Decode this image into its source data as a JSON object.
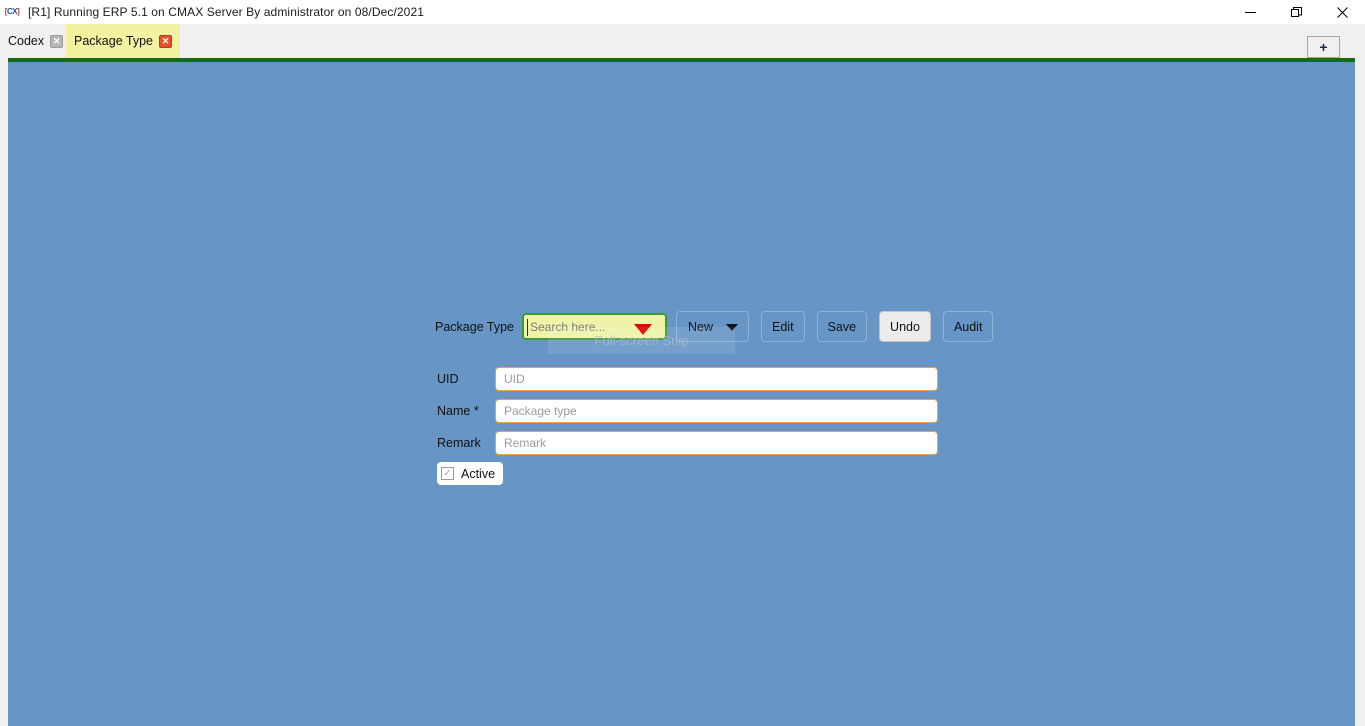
{
  "window": {
    "app_icon_label": "CX",
    "title": "[R1] Running ERP 5.1 on CMAX Server By administrator on 08/Dec/2021",
    "controls": {
      "minimize": "—",
      "maximize": "❐",
      "close": "✕"
    }
  },
  "tabs": {
    "items": [
      {
        "label": "Codex",
        "close": "✕",
        "active": false
      },
      {
        "label": "Package Type",
        "close": "✕",
        "active": true
      }
    ],
    "new_tab_label": "+"
  },
  "form": {
    "package_type_label": "Package Type",
    "search": {
      "placeholder": "Search here...",
      "value": ""
    },
    "buttons": {
      "new": "New",
      "edit": "Edit",
      "save": "Save",
      "undo": "Undo",
      "audit": "Audit"
    },
    "fields": [
      {
        "label": "UID",
        "placeholder": "UID",
        "value": ""
      },
      {
        "label": "Name *",
        "placeholder": "Package type",
        "value": ""
      },
      {
        "label": "Remark",
        "placeholder": "Remark",
        "value": ""
      }
    ],
    "active": {
      "label": "Active",
      "checkmark": "✓",
      "checked": true
    }
  },
  "overlay": {
    "snip_tooltip": "Full-screen Snip"
  },
  "colors": {
    "content_background": "#6795c6",
    "green_divider": "#146b18",
    "active_tab": "#f2f2a0",
    "search_field": "#eef3a8",
    "search_border": "#3b9c36",
    "search_arrow": "#e00000",
    "input_border": "#e8a93c",
    "tab_close_active": "#e8512c"
  }
}
